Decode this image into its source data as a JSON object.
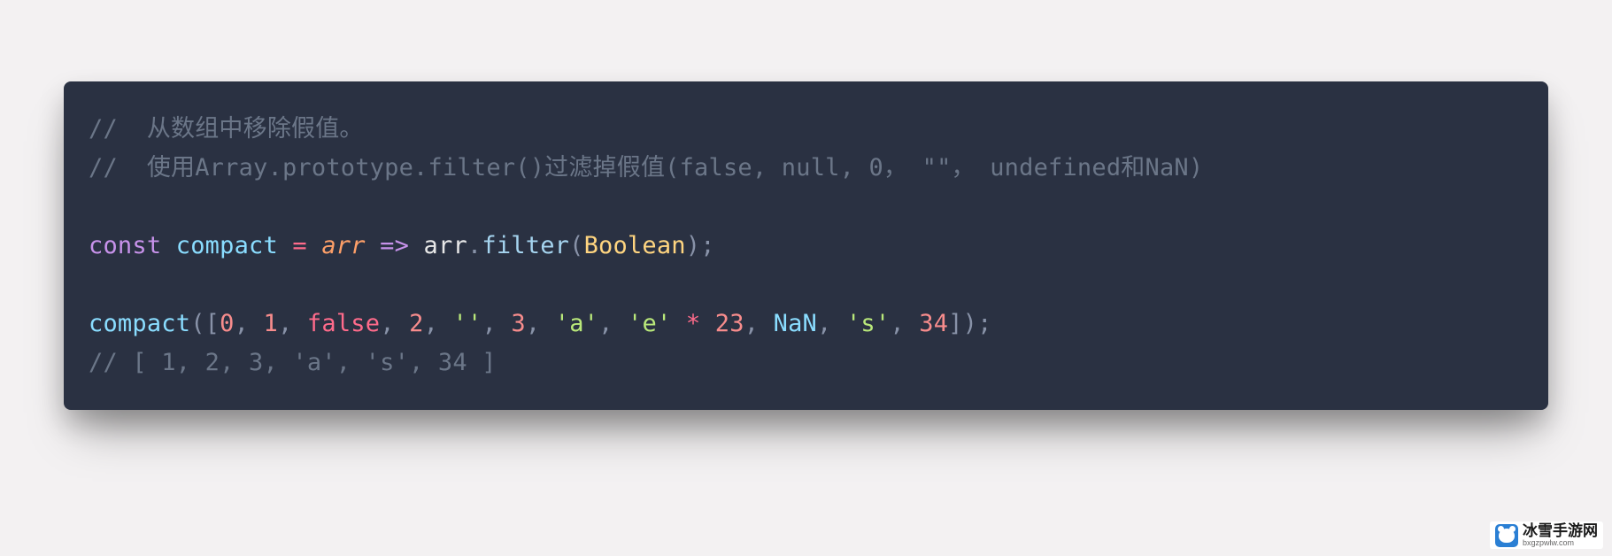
{
  "code": {
    "comment1": "//  从数组中移除假值。",
    "comment2": "//  使用Array.prototype.filter()过滤掉假值(false, null, 0， \"\"， undefined和NaN)",
    "line3": {
      "const": "const",
      "name": "compact",
      "eq": " = ",
      "param": "arr",
      "arrow": " => ",
      "ident": "arr",
      "dot": ".",
      "method": "filter",
      "open": "(",
      "class": "Boolean",
      "close": ")",
      "semi": ";"
    },
    "line4": {
      "fn": "compact",
      "open": "(",
      "bracket_open": "[",
      "n0": "0",
      "c": ", ",
      "n1": "1",
      "false": "false",
      "n2": "2",
      "s_empty": "''",
      "n3": "3",
      "s_a": "'a'",
      "s_e": "'e'",
      "star": " * ",
      "n23": "23",
      "nan": "NaN",
      "s_s": "'s'",
      "n34": "34",
      "bracket_close": "]",
      "close": ")",
      "semi": ";"
    },
    "comment5": "// [ 1, 2, 3, 'a', 's', 34 ]"
  },
  "watermark": {
    "title": "冰雪手游网",
    "url": "bxgzpwlw.com"
  }
}
